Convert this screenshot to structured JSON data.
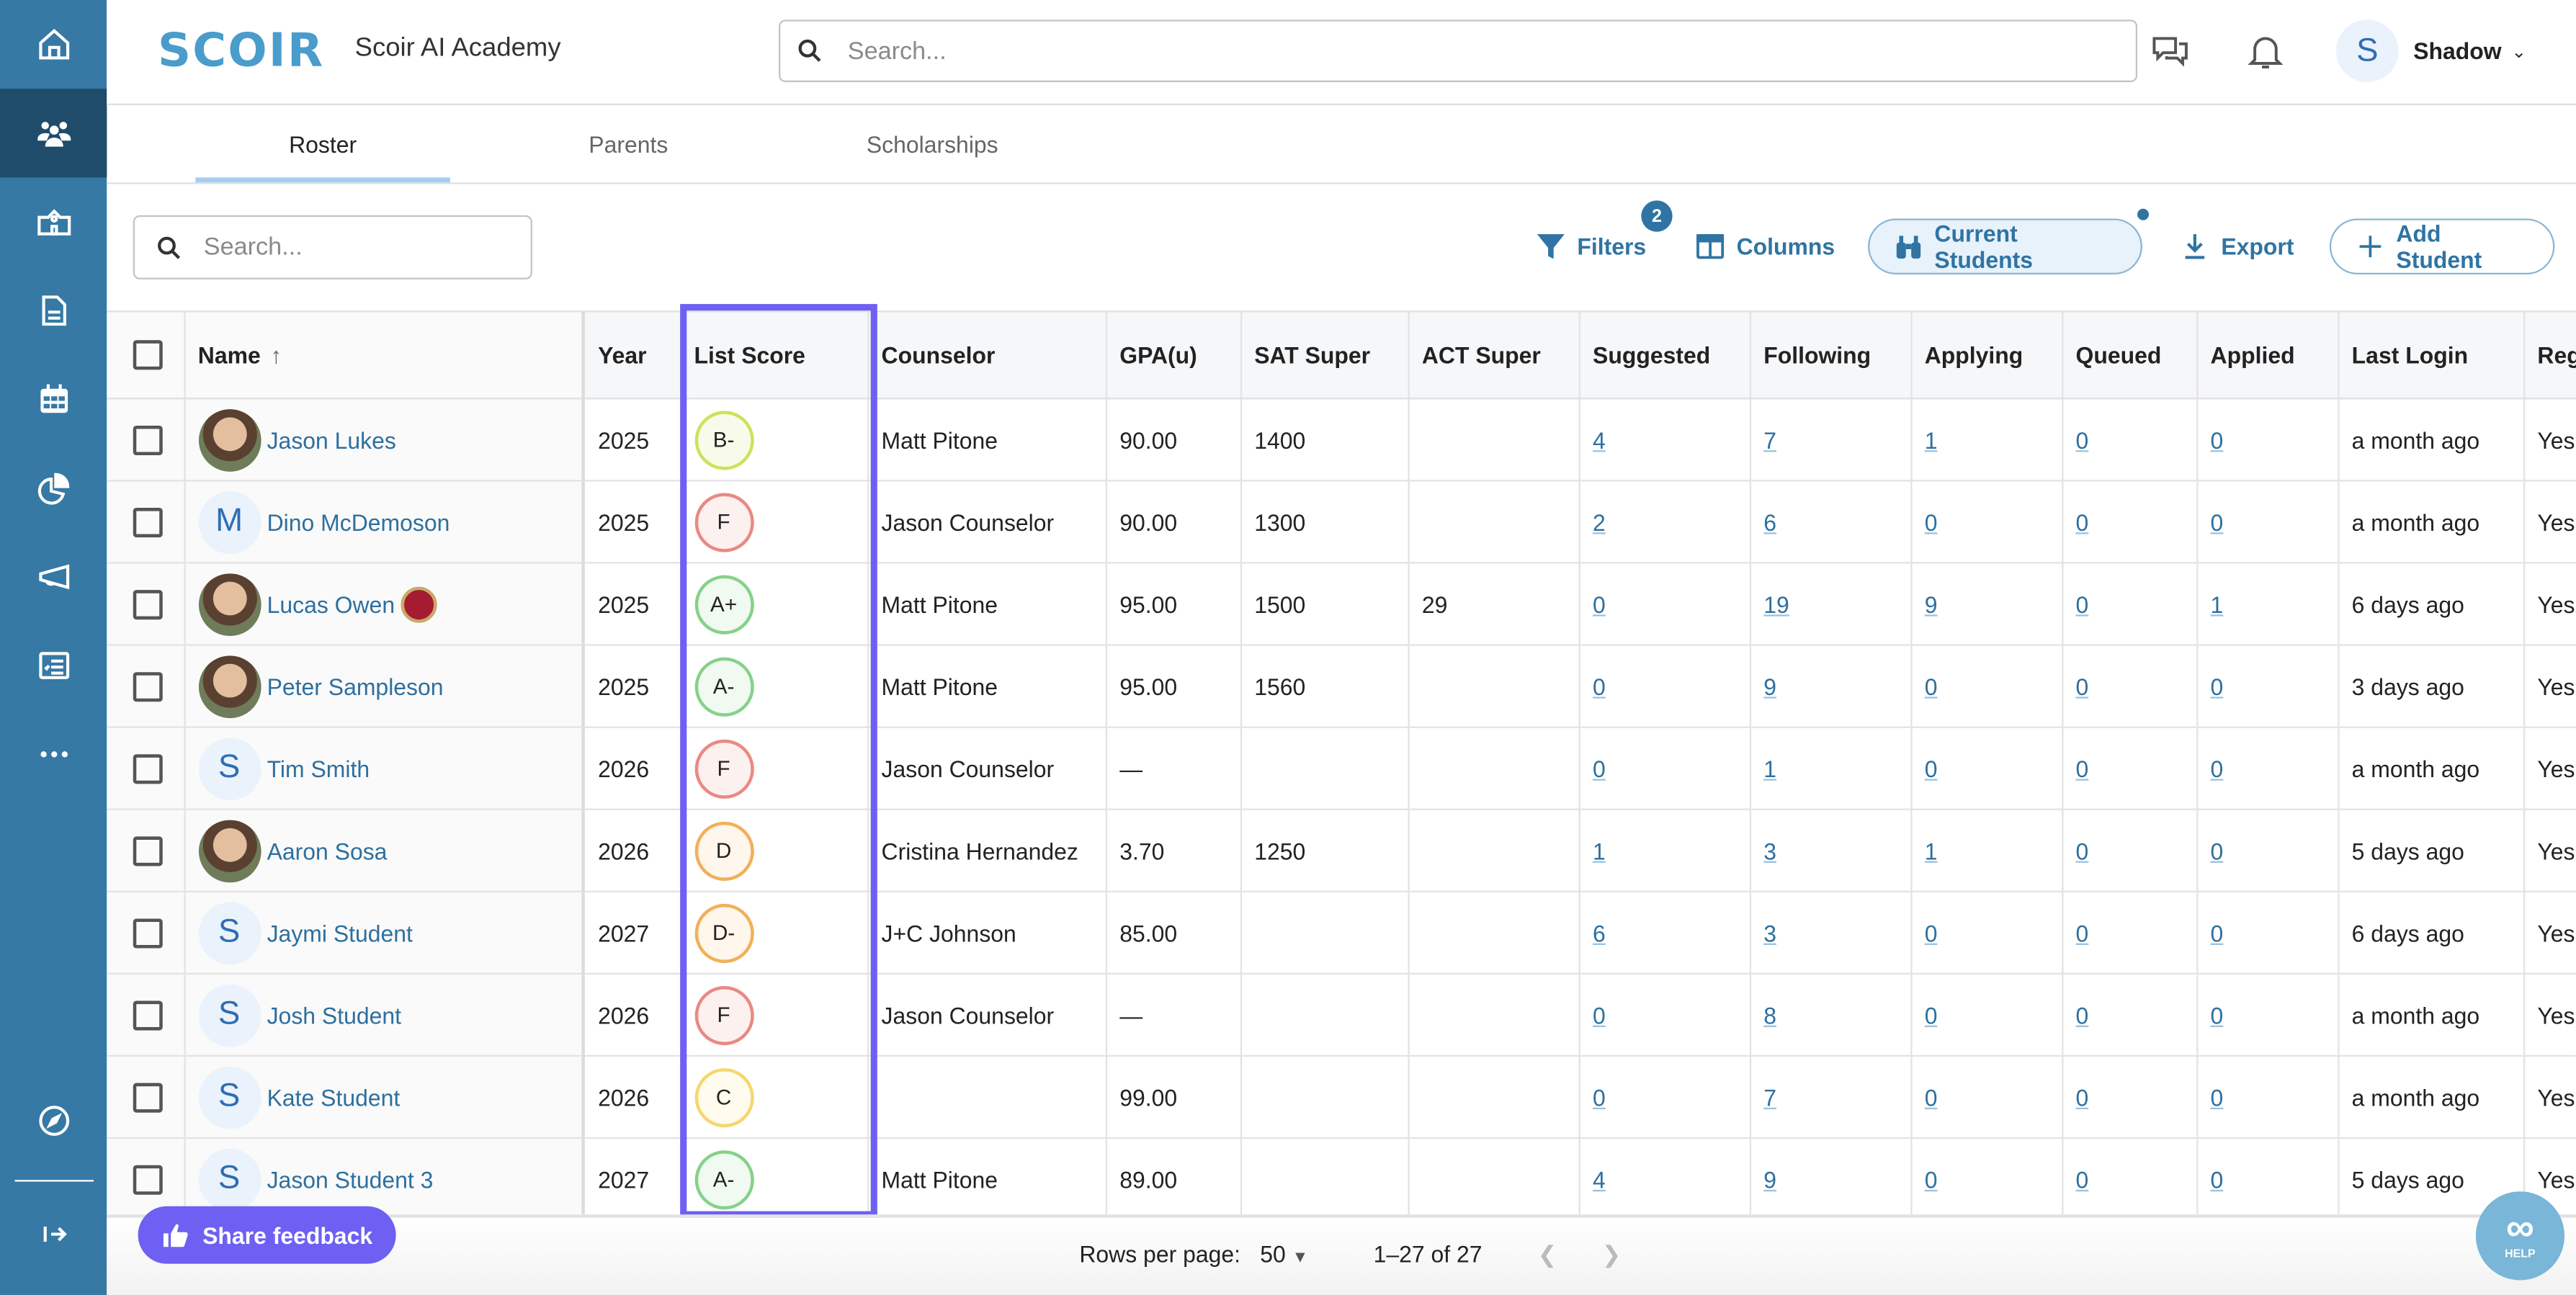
{
  "app": {
    "logo_text": "SCOIR",
    "school_name": "Scoir AI Academy",
    "search_placeholder": "Search...",
    "user_initial": "S",
    "user_name": "Shadow"
  },
  "sidebar": {
    "items": [
      {
        "name": "home",
        "icon": "home-icon"
      },
      {
        "name": "students",
        "icon": "users-icon",
        "active": true
      },
      {
        "name": "schools",
        "icon": "school-building-icon"
      },
      {
        "name": "documents",
        "icon": "document-icon"
      },
      {
        "name": "calendar",
        "icon": "calendar-icon"
      },
      {
        "name": "reports",
        "icon": "pie-chart-icon"
      },
      {
        "name": "announcements",
        "icon": "megaphone-icon"
      },
      {
        "name": "checklists",
        "icon": "checklist-icon"
      },
      {
        "name": "more",
        "icon": "more-dots-icon"
      },
      {
        "name": "explore",
        "icon": "compass-icon"
      },
      {
        "name": "expand",
        "icon": "expand-sidebar-icon"
      }
    ]
  },
  "tabs": [
    {
      "label": "Roster",
      "active": true
    },
    {
      "label": "Parents",
      "active": false
    },
    {
      "label": "Scholarships",
      "active": false
    }
  ],
  "toolbar": {
    "search_placeholder": "Search...",
    "filters_label": "Filters",
    "filters_count": "2",
    "columns_label": "Columns",
    "current_students_label": "Current Students",
    "export_label": "Export",
    "add_student_label": "Add Student"
  },
  "table": {
    "columns": [
      "Name",
      "Year",
      "List Score",
      "Counselor",
      "GPA(u)",
      "SAT Super",
      "ACT Super",
      "Suggested",
      "Following",
      "Applying",
      "Queued",
      "Applied",
      "Last Login",
      "Reg"
    ],
    "sort": {
      "column": "Name",
      "direction": "ascending"
    },
    "score_colors": {
      "A": {
        "border": "#86d18b",
        "bg": "#f1faf1"
      },
      "B": {
        "border": "#cfe15a",
        "bg": "#f9fbea"
      },
      "C": {
        "border": "#f4d76e",
        "bg": "#fffbee"
      },
      "D": {
        "border": "#f1b05a",
        "bg": "#fff6ec"
      },
      "F": {
        "border": "#e98a83",
        "bg": "#fdf1f0"
      }
    },
    "rows": [
      {
        "name": "Jason Lukes",
        "avatar": "photo",
        "initial": "",
        "badge": false,
        "year": "2025",
        "score": "B-",
        "counselor": "Matt Pitone",
        "gpa": "90.00",
        "sat": "1400",
        "act": "",
        "suggested": "4",
        "following": "7",
        "applying": "1",
        "queued": "0",
        "applied": "0",
        "last_login": "a month ago",
        "reg": "Yes"
      },
      {
        "name": "Dino McDemoson",
        "avatar": "initial",
        "initial": "M",
        "badge": false,
        "year": "2025",
        "score": "F",
        "counselor": "Jason Counselor",
        "gpa": "90.00",
        "sat": "1300",
        "act": "",
        "suggested": "2",
        "following": "6",
        "applying": "0",
        "queued": "0",
        "applied": "0",
        "last_login": "a month ago",
        "reg": "Yes"
      },
      {
        "name": "Lucas Owen",
        "avatar": "photo",
        "initial": "",
        "badge": true,
        "year": "2025",
        "score": "A+",
        "counselor": "Matt Pitone",
        "gpa": "95.00",
        "sat": "1500",
        "act": "29",
        "suggested": "0",
        "following": "19",
        "applying": "9",
        "queued": "0",
        "applied": "1",
        "last_login": "6 days ago",
        "reg": "Yes"
      },
      {
        "name": "Peter Sampleson",
        "avatar": "photo",
        "initial": "",
        "badge": false,
        "year": "2025",
        "score": "A-",
        "counselor": "Matt Pitone",
        "gpa": "95.00",
        "sat": "1560",
        "act": "",
        "suggested": "0",
        "following": "9",
        "applying": "0",
        "queued": "0",
        "applied": "0",
        "last_login": "3 days ago",
        "reg": "Yes"
      },
      {
        "name": "Tim Smith",
        "avatar": "initial",
        "initial": "S",
        "badge": false,
        "year": "2026",
        "score": "F",
        "counselor": "Jason Counselor",
        "gpa": "—",
        "sat": "",
        "act": "",
        "suggested": "0",
        "following": "1",
        "applying": "0",
        "queued": "0",
        "applied": "0",
        "last_login": "a month ago",
        "reg": "Yes"
      },
      {
        "name": "Aaron Sosa",
        "avatar": "photo",
        "initial": "",
        "badge": false,
        "year": "2026",
        "score": "D",
        "counselor": "Cristina Hernandez",
        "gpa": "3.70",
        "sat": "1250",
        "act": "",
        "suggested": "1",
        "following": "3",
        "applying": "1",
        "queued": "0",
        "applied": "0",
        "last_login": "5 days ago",
        "reg": "Yes"
      },
      {
        "name": "Jaymi Student",
        "avatar": "initial",
        "initial": "S",
        "badge": false,
        "year": "2027",
        "score": "D-",
        "counselor": "J+C Johnson",
        "gpa": "85.00",
        "sat": "",
        "act": "",
        "suggested": "6",
        "following": "3",
        "applying": "0",
        "queued": "0",
        "applied": "0",
        "last_login": "6 days ago",
        "reg": "Yes"
      },
      {
        "name": "Josh Student",
        "avatar": "initial",
        "initial": "S",
        "badge": false,
        "year": "2026",
        "score": "F",
        "counselor": "Jason Counselor",
        "gpa": "—",
        "sat": "",
        "act": "",
        "suggested": "0",
        "following": "8",
        "applying": "0",
        "queued": "0",
        "applied": "0",
        "last_login": "a month ago",
        "reg": "Yes"
      },
      {
        "name": "Kate Student",
        "avatar": "initial",
        "initial": "S",
        "badge": false,
        "year": "2026",
        "score": "C",
        "counselor": "",
        "gpa": "99.00",
        "sat": "",
        "act": "",
        "suggested": "0",
        "following": "7",
        "applying": "0",
        "queued": "0",
        "applied": "0",
        "last_login": "a month ago",
        "reg": "Yes"
      },
      {
        "name": "Jason Student 3",
        "avatar": "initial",
        "initial": "S",
        "badge": false,
        "year": "2027",
        "score": "A-",
        "counselor": "Matt Pitone",
        "gpa": "89.00",
        "sat": "",
        "act": "",
        "suggested": "4",
        "following": "9",
        "applying": "0",
        "queued": "0",
        "applied": "0",
        "last_login": "5 days ago",
        "reg": "Yes"
      }
    ]
  },
  "footer": {
    "feedback_label": "Share feedback",
    "rows_per_page_label": "Rows per page:",
    "rows_per_page_value": "50",
    "range_label": "1–27 of 27",
    "help_label": "HELP"
  },
  "colors": {
    "brand": "#3679a5",
    "link": "#2e6f9e",
    "highlight": "#6e60f2"
  }
}
